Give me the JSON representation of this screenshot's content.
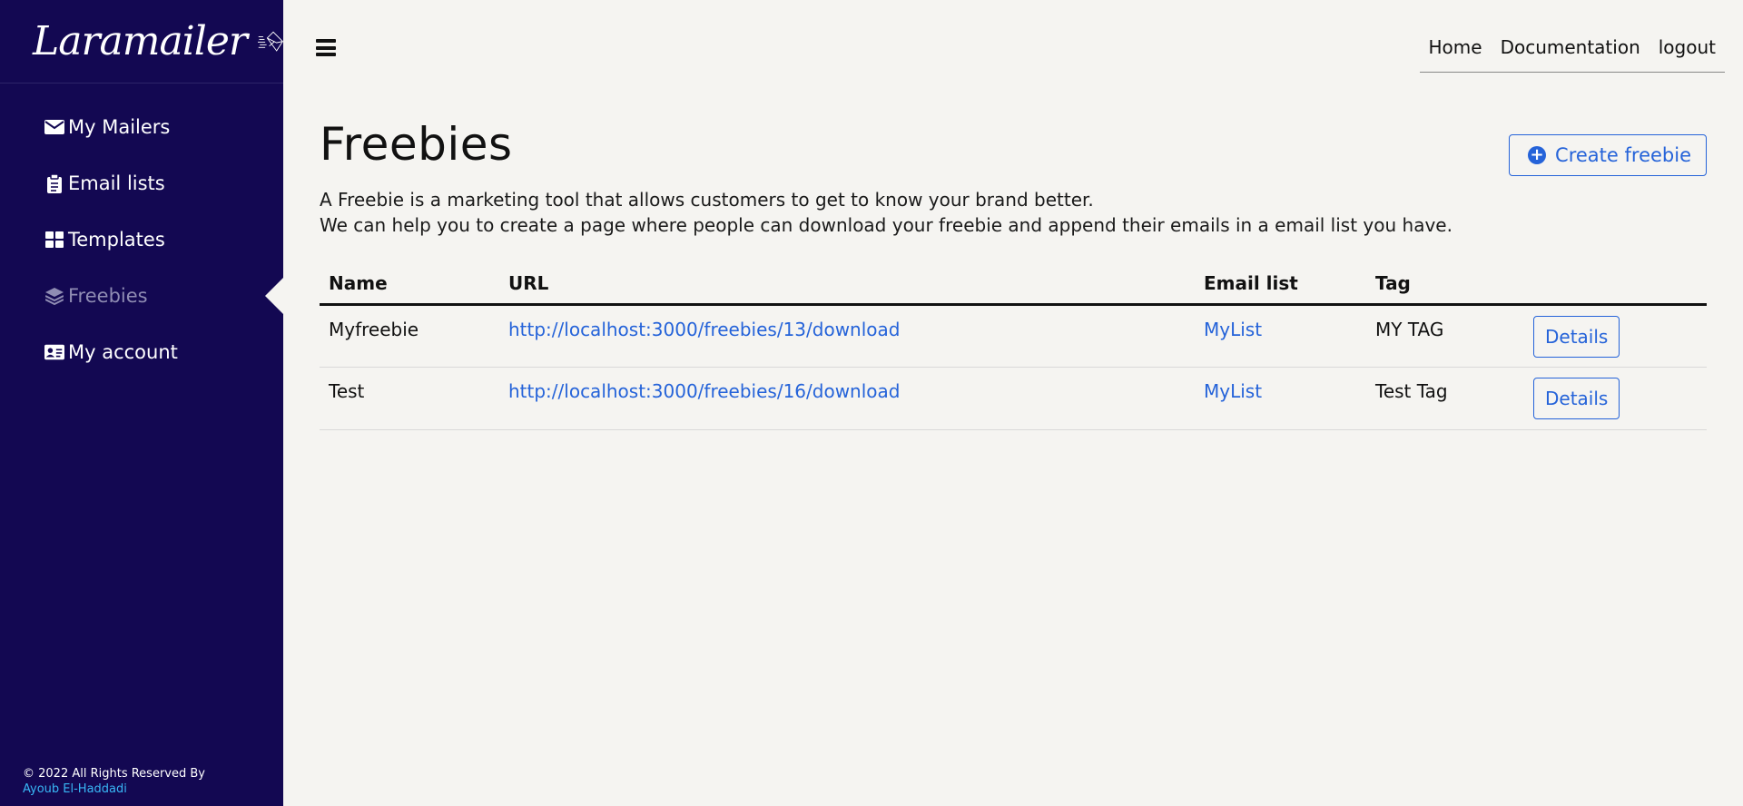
{
  "brand": {
    "name": "Laramailer",
    "logo_icon": "envelope-logo-icon"
  },
  "sidebar": {
    "items": [
      {
        "label": "My Mailers",
        "icon": "envelope-icon",
        "active": false
      },
      {
        "label": "Email lists",
        "icon": "clipboard-icon",
        "active": false
      },
      {
        "label": "Templates",
        "icon": "grid-icon",
        "active": false
      },
      {
        "label": "Freebies",
        "icon": "layers-icon",
        "active": true
      },
      {
        "label": "My account",
        "icon": "id-card-icon",
        "active": false
      }
    ],
    "footer": {
      "copyright": "© 2022 All Rights Reserved By",
      "author": "Ayoub El-Haddadi"
    }
  },
  "topbar": {
    "menu_icon": "hamburger-icon",
    "links": [
      "Home",
      "Documentation",
      "logout"
    ]
  },
  "main": {
    "title": "Freebies",
    "description": [
      "A Freebie is a marketing tool that allows customers to get to know your brand better.",
      "We can help you to create a page where people can download your freebie and append their emails in a email list you have."
    ],
    "create_button": {
      "label": "Create freebie",
      "icon": "plus-circle-icon"
    },
    "table": {
      "headers": [
        "Name",
        "URL",
        "Email list",
        "Tag",
        ""
      ],
      "rows": [
        {
          "name": "Myfreebie",
          "url": "http://localhost:3000/freebies/13/download",
          "email_list": "MyList",
          "tag": "MY TAG",
          "action": "Details"
        },
        {
          "name": "Test",
          "url": "http://localhost:3000/freebies/16/download",
          "email_list": "MyList",
          "tag": "Test Tag",
          "action": "Details"
        }
      ]
    }
  },
  "colors": {
    "sidebar_bg": "#130852",
    "page_bg": "#f5f4f1",
    "accent": "#2563d9",
    "footer_author": "#38b6f5"
  }
}
